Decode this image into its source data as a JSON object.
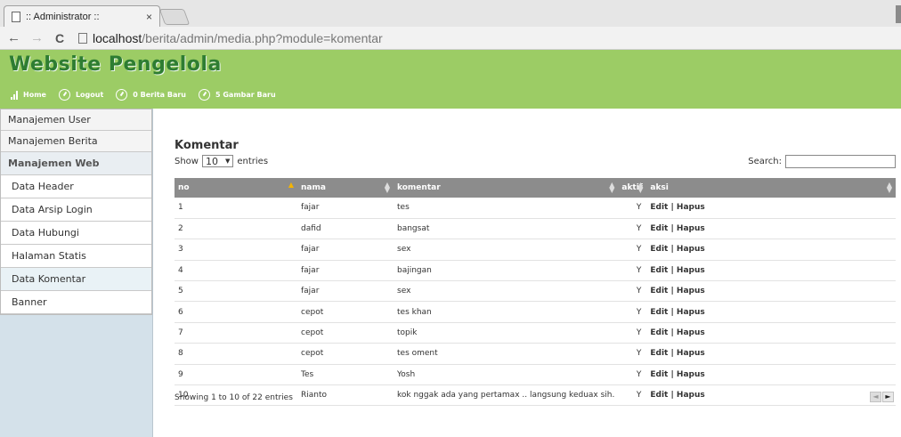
{
  "browser": {
    "tab_title": ":: Administrator ::",
    "tab_close": "×",
    "url_host": "localhost",
    "url_path": "/berita/admin/media.php?module=komentar"
  },
  "header": {
    "site_title": "Website Pengelola",
    "nav": [
      {
        "label": "Home",
        "icon": "bars-icon"
      },
      {
        "label": "Logout",
        "icon": "circle-arrow-icon"
      },
      {
        "label": "0 Berita Baru",
        "icon": "circle-arrow-icon"
      },
      {
        "label": "5 Gambar Baru",
        "icon": "circle-arrow-icon"
      }
    ]
  },
  "sidebar": {
    "items": [
      {
        "label": "Manajemen User"
      },
      {
        "label": "Manajemen Berita"
      },
      {
        "label": "Manajemen Web"
      }
    ],
    "subitems": [
      {
        "label": "Data Header"
      },
      {
        "label": "Data Arsip Login"
      },
      {
        "label": "Data Hubungi"
      },
      {
        "label": "Halaman Statis"
      },
      {
        "label": "Data Komentar"
      },
      {
        "label": "Banner"
      }
    ]
  },
  "main": {
    "title": "Komentar",
    "length": {
      "show": "Show",
      "value": "10",
      "entries": "entries"
    },
    "search": {
      "label": "Search:",
      "value": ""
    },
    "columns": [
      "no",
      "nama",
      "komentar",
      "aktif",
      "aksi"
    ],
    "rows": [
      {
        "no": "1",
        "nama": "fajar",
        "komentar": "tes",
        "aktif": "Y",
        "edit": "Edit",
        "sep": " | ",
        "hapus": "Hapus"
      },
      {
        "no": "2",
        "nama": "dafid",
        "komentar": "bangsat",
        "aktif": "Y",
        "edit": "Edit",
        "sep": " | ",
        "hapus": "Hapus"
      },
      {
        "no": "3",
        "nama": "fajar",
        "komentar": "sex",
        "aktif": "Y",
        "edit": "Edit",
        "sep": " | ",
        "hapus": "Hapus"
      },
      {
        "no": "4",
        "nama": "fajar",
        "komentar": "bajingan",
        "aktif": "Y",
        "edit": "Edit",
        "sep": " | ",
        "hapus": "Hapus"
      },
      {
        "no": "5",
        "nama": "fajar",
        "komentar": "sex",
        "aktif": "Y",
        "edit": "Edit",
        "sep": " | ",
        "hapus": "Hapus"
      },
      {
        "no": "6",
        "nama": "cepot",
        "komentar": "tes khan",
        "aktif": "Y",
        "edit": "Edit",
        "sep": " | ",
        "hapus": "Hapus"
      },
      {
        "no": "7",
        "nama": "cepot",
        "komentar": "topik",
        "aktif": "Y",
        "edit": "Edit",
        "sep": " | ",
        "hapus": "Hapus"
      },
      {
        "no": "8",
        "nama": "cepot",
        "komentar": "tes oment",
        "aktif": "Y",
        "edit": "Edit",
        "sep": " | ",
        "hapus": "Hapus"
      },
      {
        "no": "9",
        "nama": "Tes",
        "komentar": "Yosh",
        "aktif": "Y",
        "edit": "Edit",
        "sep": " | ",
        "hapus": "Hapus"
      },
      {
        "no": "10",
        "nama": "Rianto",
        "komentar": "kok nggak ada yang pertamax .. langsung keduax sih.",
        "aktif": "Y",
        "edit": "Edit",
        "sep": " | ",
        "hapus": "Hapus"
      }
    ],
    "info": "Showing 1 to 10 of 22 entries",
    "pager": {
      "prev": "◄",
      "next": "►"
    }
  },
  "colors": {
    "header_green": "#9ccc65",
    "title_green": "#2e7d32",
    "table_header": "#8c8c8c",
    "sidebar_bg": "#d4e1ea"
  }
}
